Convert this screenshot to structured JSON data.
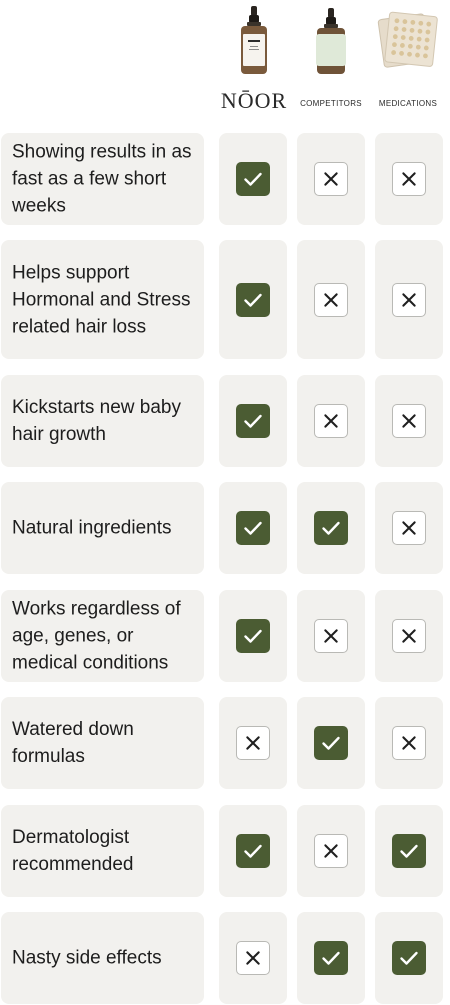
{
  "colors": {
    "cell_bg": "#f2f1ee",
    "check_bg": "#4b5c33",
    "check_mark": "#ffffff",
    "cross_bg": "#ffffff",
    "cross_border": "#b9b9b5",
    "cross_mark": "#1f1f1f"
  },
  "header": {
    "columns": [
      {
        "image": "serum-bottle-noor",
        "label": "NŌOR"
      },
      {
        "image": "serum-bottle-blurred-label",
        "label": "COMPETITORS"
      },
      {
        "image": "pill-blister-packs",
        "label": "MEDICATIONS"
      }
    ]
  },
  "rows": [
    {
      "feature": "Showing results in as fast as a few short weeks",
      "values": [
        true,
        false,
        false
      ]
    },
    {
      "feature": "Helps support Hormonal and Stress related hair loss",
      "values": [
        true,
        false,
        false
      ]
    },
    {
      "feature": "Kickstarts new baby hair growth",
      "values": [
        true,
        false,
        false
      ]
    },
    {
      "feature": "Natural ingredients",
      "values": [
        true,
        true,
        false
      ]
    },
    {
      "feature": "Works regardless of age, genes, or medical conditions",
      "values": [
        true,
        false,
        false
      ]
    },
    {
      "feature": "Watered down formulas",
      "values": [
        false,
        true,
        false
      ]
    },
    {
      "feature": "Dermatologist recommended",
      "values": [
        true,
        false,
        true
      ]
    },
    {
      "feature": "Nasty side effects",
      "values": [
        false,
        true,
        true
      ]
    }
  ]
}
